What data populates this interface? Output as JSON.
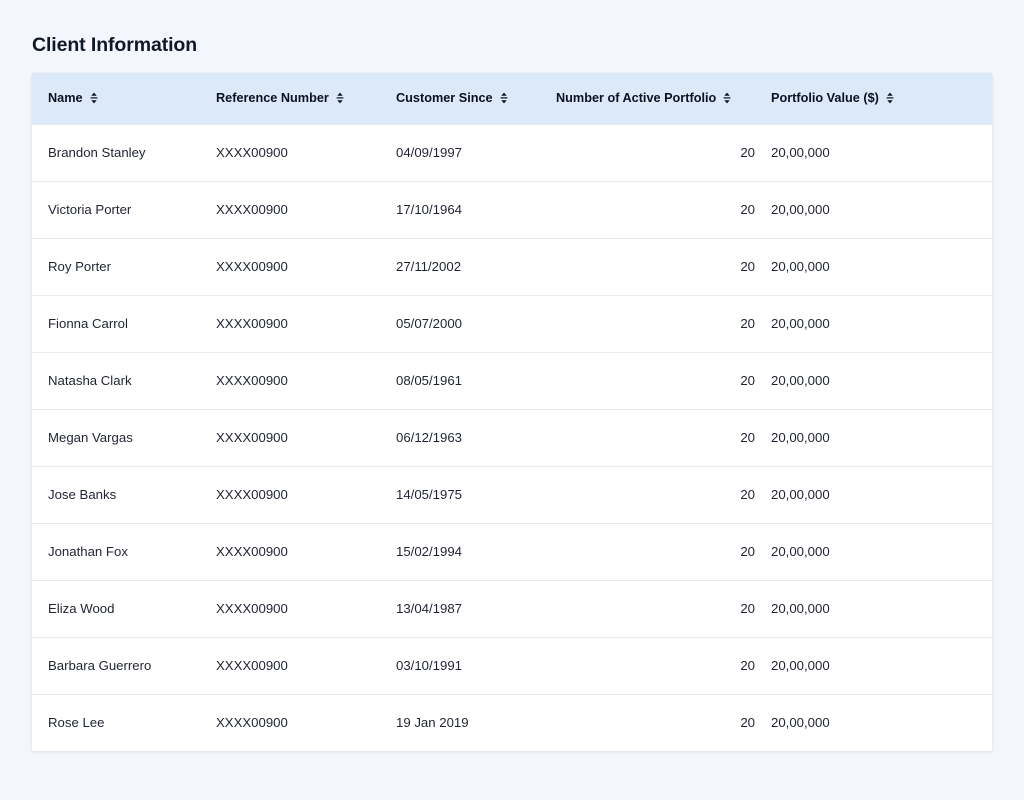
{
  "page": {
    "title": "Client Information",
    "background_color": "#f3f7fd",
    "accent_header_color": "#dce9f9",
    "text_color": "#1f2430"
  },
  "table": {
    "sort_icon_name": "sort-updown-icon",
    "columns": [
      {
        "key": "name",
        "label": "Name",
        "align": "left",
        "sortable": true
      },
      {
        "key": "ref",
        "label": "Reference Number",
        "align": "left",
        "sortable": true
      },
      {
        "key": "since",
        "label": "Customer Since",
        "align": "left",
        "sortable": true
      },
      {
        "key": "active",
        "label": "Number of Active Portfolio",
        "align": "left",
        "sortable": true
      },
      {
        "key": "value",
        "label": "Portfolio Value ($)",
        "align": "left",
        "sortable": true
      }
    ],
    "rows": [
      {
        "name": "Brandon Stanley",
        "ref": "XXXX00900",
        "since": "04/09/1997",
        "active": "20",
        "value": "20,00,000"
      },
      {
        "name": "Victoria Porter",
        "ref": "XXXX00900",
        "since": "17/10/1964",
        "active": "20",
        "value": "20,00,000"
      },
      {
        "name": "Roy Porter",
        "ref": "XXXX00900",
        "since": "27/11/2002",
        "active": "20",
        "value": "20,00,000"
      },
      {
        "name": "Fionna Carrol",
        "ref": "XXXX00900",
        "since": "05/07/2000",
        "active": "20",
        "value": "20,00,000"
      },
      {
        "name": "Natasha Clark",
        "ref": "XXXX00900",
        "since": "08/05/1961",
        "active": "20",
        "value": "20,00,000"
      },
      {
        "name": "Megan Vargas",
        "ref": "XXXX00900",
        "since": "06/12/1963",
        "active": "20",
        "value": "20,00,000"
      },
      {
        "name": "Jose Banks",
        "ref": "XXXX00900",
        "since": "14/05/1975",
        "active": "20",
        "value": "20,00,000"
      },
      {
        "name": "Jonathan Fox",
        "ref": "XXXX00900",
        "since": "15/02/1994",
        "active": "20",
        "value": "20,00,000"
      },
      {
        "name": "Eliza Wood",
        "ref": "XXXX00900",
        "since": "13/04/1987",
        "active": "20",
        "value": "20,00,000"
      },
      {
        "name": "Barbara Guerrero",
        "ref": "XXXX00900",
        "since": "03/10/1991",
        "active": "20",
        "value": "20,00,000"
      },
      {
        "name": "Rose Lee",
        "ref": "XXXX00900",
        "since": "19 Jan 2019",
        "active": "20",
        "value": "20,00,000"
      }
    ]
  }
}
